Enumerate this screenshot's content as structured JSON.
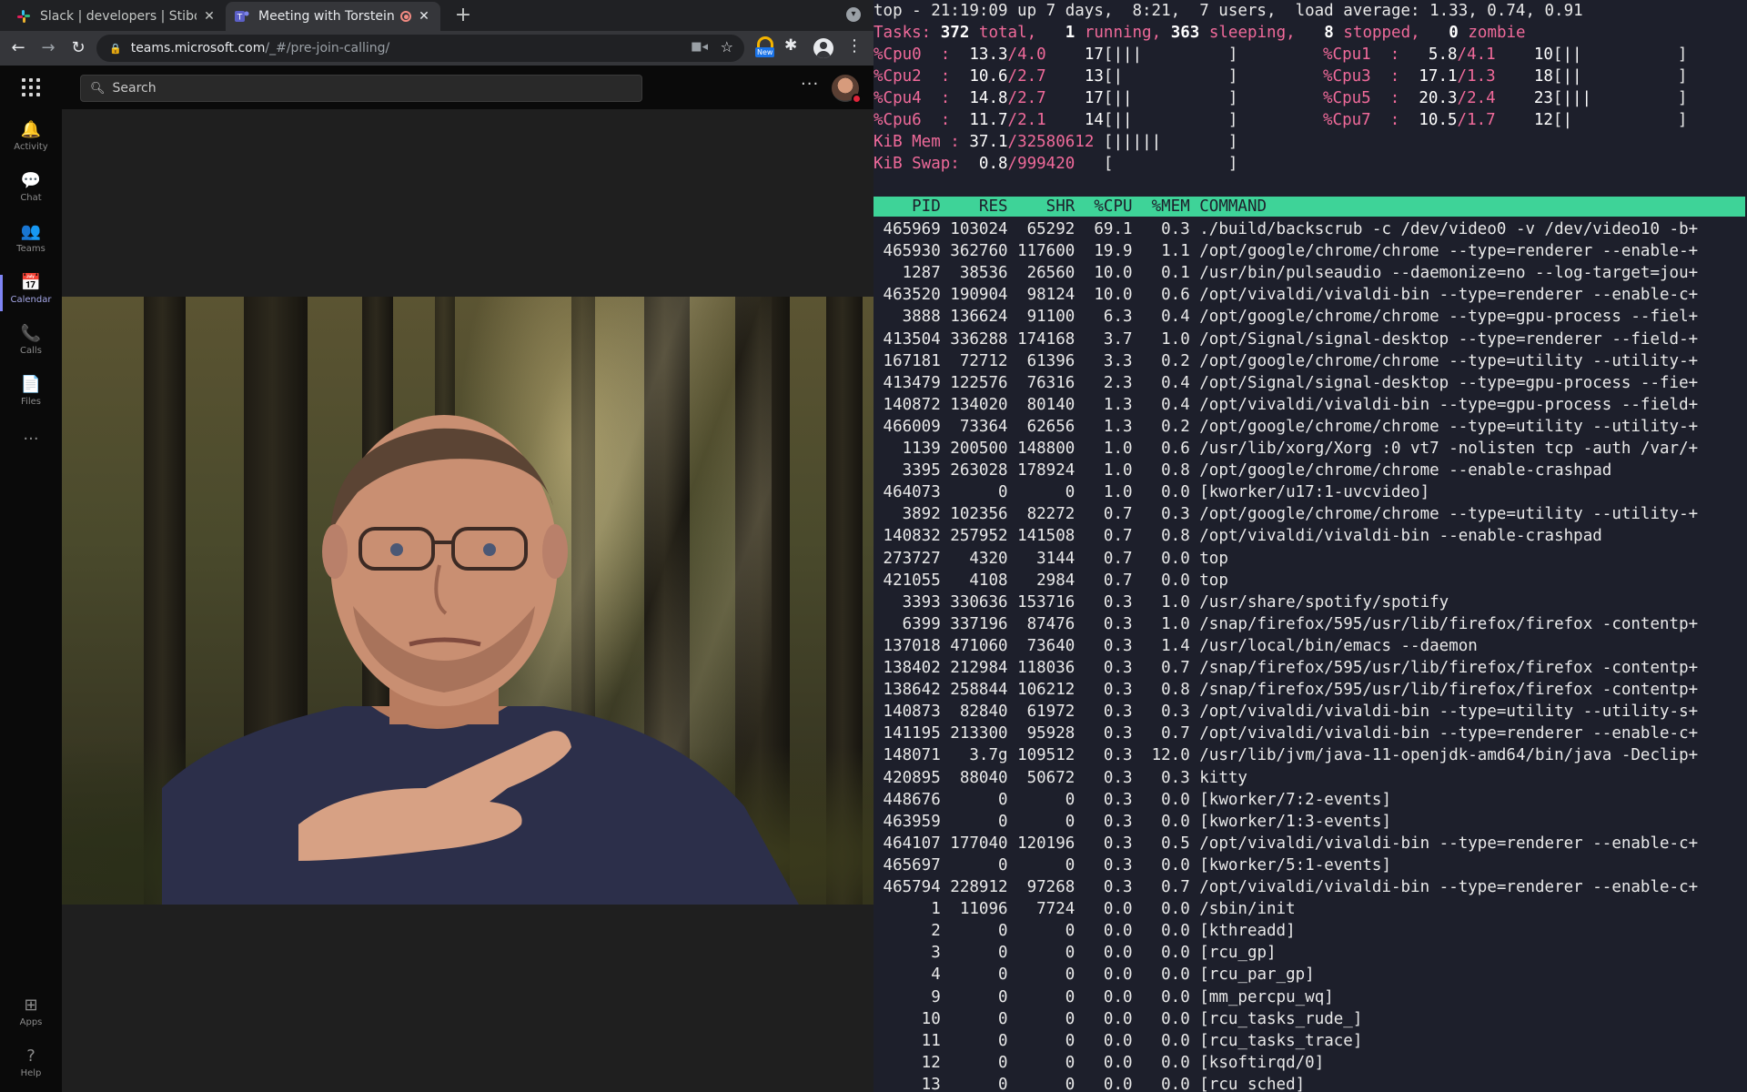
{
  "browser": {
    "tabs": [
      {
        "title": "Slack | developers | Stibo C",
        "favicon": "slack-icon",
        "close": "✕"
      },
      {
        "title": "Meeting with Torstein K",
        "favicon": "teams-icon",
        "close": "✕",
        "recording": true
      }
    ],
    "new_tab": "+",
    "url_host": "teams.microsoft.com",
    "url_path": "/_#/pre-join-calling/",
    "extension_badge": "New"
  },
  "teams": {
    "search_placeholder": "Search",
    "rail": [
      {
        "label": "Activity",
        "icon": "bell-icon",
        "glyph": "🔔"
      },
      {
        "label": "Chat",
        "icon": "chat-icon",
        "glyph": "💬"
      },
      {
        "label": "Teams",
        "icon": "teams-icon",
        "glyph": "👥"
      },
      {
        "label": "Calendar",
        "icon": "calendar-icon",
        "glyph": "📅",
        "active": true
      },
      {
        "label": "Calls",
        "icon": "phone-icon",
        "glyph": "📞"
      },
      {
        "label": "Files",
        "icon": "file-icon",
        "glyph": "📄"
      }
    ],
    "rail_more": "···",
    "rail_bottom": [
      {
        "label": "Apps",
        "icon": "apps-icon",
        "glyph": "⊞"
      },
      {
        "label": "Help",
        "icon": "help-icon",
        "glyph": "?"
      }
    ],
    "header_more": "···",
    "accent": "#7f85f5"
  },
  "terminal": {
    "summary": {
      "clock": "top - 21:19:09 up 7 days,  8:21,  7 users,  load average: 1.33, 0.74, 0.91",
      "tasks_label": "Tasks:",
      "tasks_total": "372",
      "total_word": "total,",
      "running": "1",
      "running_word": "running,",
      "sleeping": "363",
      "sleeping_word": "sleeping,",
      "stopped": "8",
      "stopped_word": "stopped,",
      "zombie": "0",
      "zombie_word": "zombie"
    },
    "cpus": [
      {
        "label": "%Cpu0  :",
        "user": "13.3",
        "sys": "4.0",
        "pct": "17",
        "bars": "|||"
      },
      {
        "label": "%Cpu1  :",
        "user": " 5.8",
        "sys": "4.1",
        "pct": "10",
        "bars": "||"
      },
      {
        "label": "%Cpu2  :",
        "user": "10.6",
        "sys": "2.7",
        "pct": "13",
        "bars": "|"
      },
      {
        "label": "%Cpu3  :",
        "user": "17.1",
        "sys": "1.3",
        "pct": "18",
        "bars": "||"
      },
      {
        "label": "%Cpu4  :",
        "user": "14.8",
        "sys": "2.7",
        "pct": "17",
        "bars": "||"
      },
      {
        "label": "%Cpu5  :",
        "user": "20.3",
        "sys": "2.4",
        "pct": "23",
        "bars": "|||"
      },
      {
        "label": "%Cpu6  :",
        "user": "11.7",
        "sys": "2.1",
        "pct": "14",
        "bars": "||"
      },
      {
        "label": "%Cpu7  :",
        "user": "10.5",
        "sys": "1.7",
        "pct": "12",
        "bars": "|"
      }
    ],
    "mem": {
      "label": "KiB Mem :",
      "pct": "37.1",
      "total": "32580612",
      "bars": "|||||"
    },
    "swap": {
      "label": "KiB Swap:",
      "pct": " 0.8",
      "total": "999420",
      "bars": ""
    },
    "columns": [
      "PID",
      "RES",
      "SHR",
      "%CPU",
      "%MEM",
      "COMMAND"
    ],
    "processes": [
      [
        "465969",
        "103024",
        "65292",
        "69.1",
        "0.3",
        "./build/backscrub -c /dev/video0 -v /dev/video10 -b+"
      ],
      [
        "465930",
        "362760",
        "117600",
        "19.9",
        "1.1",
        "/opt/google/chrome/chrome --type=renderer --enable-+"
      ],
      [
        "1287",
        "38536",
        "26560",
        "10.0",
        "0.1",
        "/usr/bin/pulseaudio --daemonize=no --log-target=jou+"
      ],
      [
        "463520",
        "190904",
        "98124",
        "10.0",
        "0.6",
        "/opt/vivaldi/vivaldi-bin --type=renderer --enable-c+"
      ],
      [
        "3888",
        "136624",
        "91100",
        "6.3",
        "0.4",
        "/opt/google/chrome/chrome --type=gpu-process --fiel+"
      ],
      [
        "413504",
        "336288",
        "174168",
        "3.7",
        "1.0",
        "/opt/Signal/signal-desktop --type=renderer --field-+"
      ],
      [
        "167181",
        "72712",
        "61396",
        "3.3",
        "0.2",
        "/opt/google/chrome/chrome --type=utility --utility-+"
      ],
      [
        "413479",
        "122576",
        "76316",
        "2.3",
        "0.4",
        "/opt/Signal/signal-desktop --type=gpu-process --fie+"
      ],
      [
        "140872",
        "134020",
        "80140",
        "1.3",
        "0.4",
        "/opt/vivaldi/vivaldi-bin --type=gpu-process --field+"
      ],
      [
        "466009",
        "73364",
        "62656",
        "1.3",
        "0.2",
        "/opt/google/chrome/chrome --type=utility --utility-+"
      ],
      [
        "1139",
        "200500",
        "148800",
        "1.0",
        "0.6",
        "/usr/lib/xorg/Xorg :0 vt7 -nolisten tcp -auth /var/+"
      ],
      [
        "3395",
        "263028",
        "178924",
        "1.0",
        "0.8",
        "/opt/google/chrome/chrome --enable-crashpad"
      ],
      [
        "464073",
        "0",
        "0",
        "1.0",
        "0.0",
        "[kworker/u17:1-uvcvideo]"
      ],
      [
        "3892",
        "102356",
        "82272",
        "0.7",
        "0.3",
        "/opt/google/chrome/chrome --type=utility --utility-+"
      ],
      [
        "140832",
        "257952",
        "141508",
        "0.7",
        "0.8",
        "/opt/vivaldi/vivaldi-bin --enable-crashpad"
      ],
      [
        "273727",
        "4320",
        "3144",
        "0.7",
        "0.0",
        "top"
      ],
      [
        "421055",
        "4108",
        "2984",
        "0.7",
        "0.0",
        "top"
      ],
      [
        "3393",
        "330636",
        "153716",
        "0.3",
        "1.0",
        "/usr/share/spotify/spotify"
      ],
      [
        "6399",
        "337196",
        "87476",
        "0.3",
        "1.0",
        "/snap/firefox/595/usr/lib/firefox/firefox -contentp+"
      ],
      [
        "137018",
        "471060",
        "73640",
        "0.3",
        "1.4",
        "/usr/local/bin/emacs --daemon"
      ],
      [
        "138402",
        "212984",
        "118036",
        "0.3",
        "0.7",
        "/snap/firefox/595/usr/lib/firefox/firefox -contentp+"
      ],
      [
        "138642",
        "258844",
        "106212",
        "0.3",
        "0.8",
        "/snap/firefox/595/usr/lib/firefox/firefox -contentp+"
      ],
      [
        "140873",
        "82840",
        "61972",
        "0.3",
        "0.3",
        "/opt/vivaldi/vivaldi-bin --type=utility --utility-s+"
      ],
      [
        "141195",
        "213300",
        "95928",
        "0.3",
        "0.7",
        "/opt/vivaldi/vivaldi-bin --type=renderer --enable-c+"
      ],
      [
        "148071",
        "3.7g",
        "109512",
        "0.3",
        "12.0",
        "/usr/lib/jvm/java-11-openjdk-amd64/bin/java -Declip+"
      ],
      [
        "420895",
        "88040",
        "50672",
        "0.3",
        "0.3",
        "kitty"
      ],
      [
        "448676",
        "0",
        "0",
        "0.3",
        "0.0",
        "[kworker/7:2-events]"
      ],
      [
        "463959",
        "0",
        "0",
        "0.3",
        "0.0",
        "[kworker/1:3-events]"
      ],
      [
        "464107",
        "177040",
        "120196",
        "0.3",
        "0.5",
        "/opt/vivaldi/vivaldi-bin --type=renderer --enable-c+"
      ],
      [
        "465697",
        "0",
        "0",
        "0.3",
        "0.0",
        "[kworker/5:1-events]"
      ],
      [
        "465794",
        "228912",
        "97268",
        "0.3",
        "0.7",
        "/opt/vivaldi/vivaldi-bin --type=renderer --enable-c+"
      ],
      [
        "1",
        "11096",
        "7724",
        "0.0",
        "0.0",
        "/sbin/init"
      ],
      [
        "2",
        "0",
        "0",
        "0.0",
        "0.0",
        "[kthreadd]"
      ],
      [
        "3",
        "0",
        "0",
        "0.0",
        "0.0",
        "[rcu_gp]"
      ],
      [
        "4",
        "0",
        "0",
        "0.0",
        "0.0",
        "[rcu_par_gp]"
      ],
      [
        "9",
        "0",
        "0",
        "0.0",
        "0.0",
        "[mm_percpu_wq]"
      ],
      [
        "10",
        "0",
        "0",
        "0.0",
        "0.0",
        "[rcu_tasks_rude_]"
      ],
      [
        "11",
        "0",
        "0",
        "0.0",
        "0.0",
        "[rcu_tasks_trace]"
      ],
      [
        "12",
        "0",
        "0",
        "0.0",
        "0.0",
        "[ksoftirqd/0]"
      ],
      [
        "13",
        "0",
        "0",
        "0.0",
        "0.0",
        "[rcu_sched]"
      ]
    ],
    "colors": {
      "background": "#1d1f2b",
      "header_bar": "#3ed398",
      "accent": "#f06a9a"
    }
  }
}
